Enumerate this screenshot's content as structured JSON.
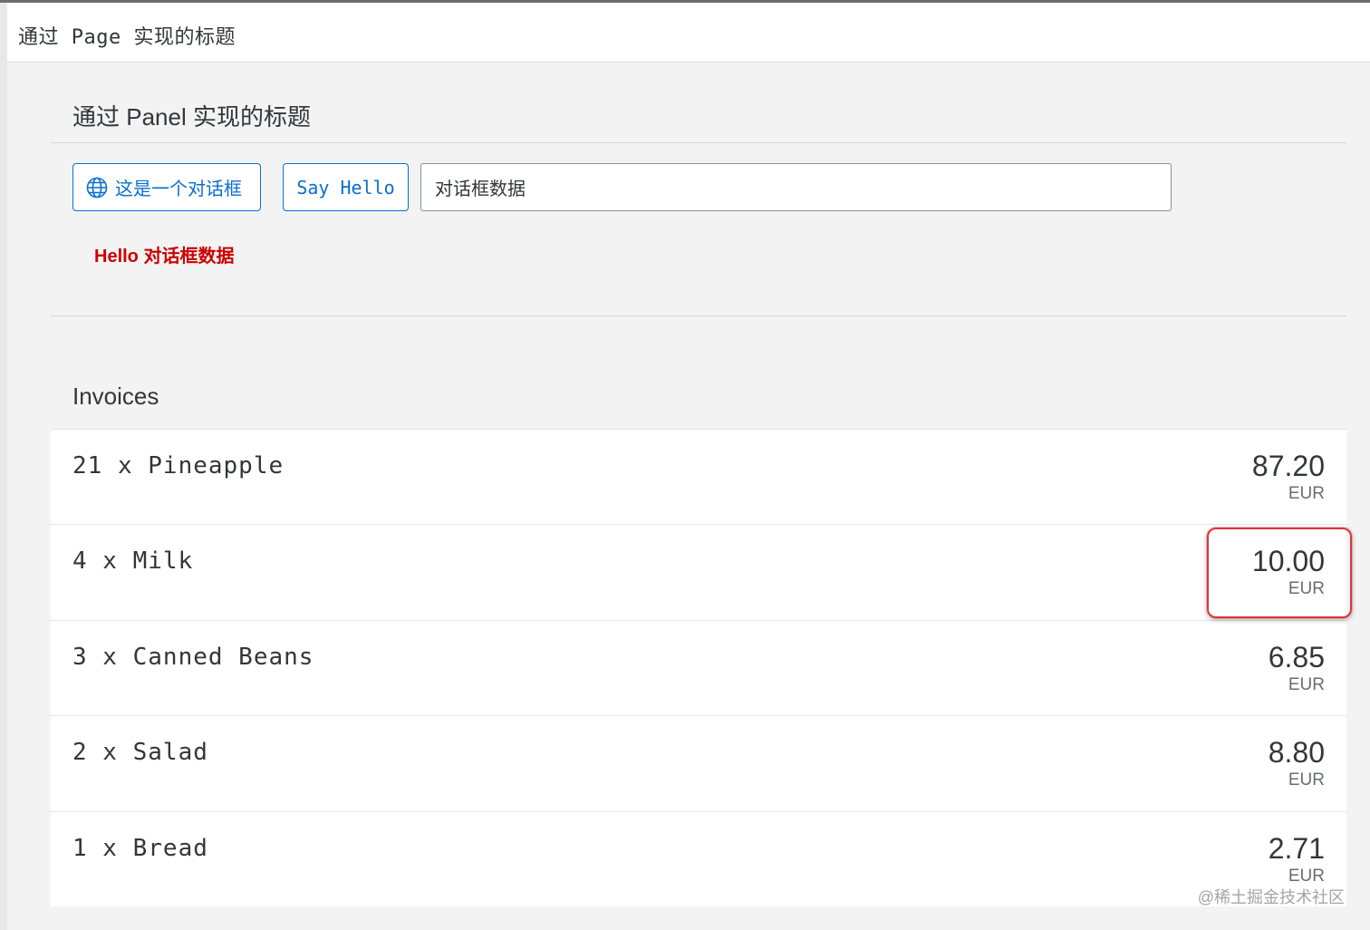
{
  "page": {
    "title": "通过 Page 实现的标题"
  },
  "panel": {
    "title": "通过 Panel 实现的标题",
    "dialog_button_label": "这是一个对话框",
    "say_hello_label": "Say Hello",
    "input_value": "对话框数据",
    "hello_message": "Hello 对话框数据"
  },
  "invoices": {
    "title": "Invoices",
    "items": [
      {
        "title": "21 x Pineapple",
        "amount": "87.20",
        "currency": "EUR"
      },
      {
        "title": "4 x Milk",
        "amount": "10.00",
        "currency": "EUR"
      },
      {
        "title": "3 x Canned Beans",
        "amount": "6.85",
        "currency": "EUR"
      },
      {
        "title": "2 x Salad",
        "amount": "8.80",
        "currency": "EUR"
      },
      {
        "title": "1 x Bread",
        "amount": "2.71",
        "currency": "EUR"
      }
    ]
  },
  "icons": {
    "dialog_button": "globe-icon"
  },
  "colors": {
    "accent": "#0a6ed1",
    "error_text": "#cc0000",
    "highlight": "#d9363e"
  },
  "watermark": "@稀土掘金技术社区"
}
